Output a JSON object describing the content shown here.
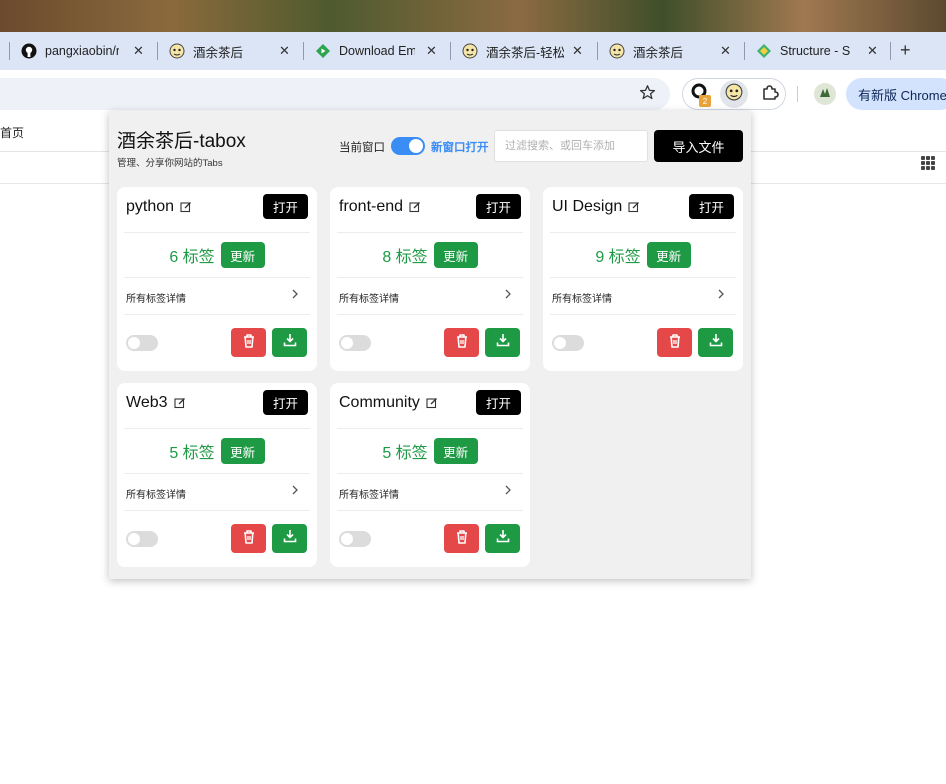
{
  "browser": {
    "tabs": [
      {
        "title": "pangxiaobin/r",
        "icon": "github-icon"
      },
      {
        "title": "酒余茶后",
        "icon": "tabox-icon"
      },
      {
        "title": "Download Em",
        "icon": "play-icon"
      },
      {
        "title": "酒余茶后-轻松",
        "icon": "tabox-icon"
      },
      {
        "title": "酒余茶后",
        "icon": "tabox-icon"
      },
      {
        "title": "Structure - S",
        "icon": "structure-icon"
      }
    ],
    "close_glyph": "✕",
    "new_tab_glyph": "+",
    "extension_badge": "2",
    "update_label": "有新版 Chrome",
    "bookmark_home": "首页",
    "accent": "#dbe5f6"
  },
  "popup": {
    "title": "酒余茶后-tabox",
    "subtitle": "管理、分享你网站的Tabs",
    "current_window_label": "当前窗口",
    "new_window_label": "新窗口打开",
    "search_placeholder": "过滤搜索、或回车添加",
    "import_label": "导入文件",
    "colors": {
      "open": "#000000",
      "count": "#1e9a45",
      "delete": "#e54848",
      "toggle_on": "#3a8df5"
    },
    "cards": [
      {
        "name": "python",
        "open_label": "打开",
        "count_text": "6 标签",
        "update_label": "更新",
        "details_label": "所有标签详情",
        "enabled": false
      },
      {
        "name": "front-end",
        "open_label": "打开",
        "count_text": "8 标签",
        "update_label": "更新",
        "details_label": "所有标签详情",
        "enabled": false
      },
      {
        "name": "UI Design",
        "open_label": "打开",
        "count_text": "9 标签",
        "update_label": "更新",
        "details_label": "所有标签详情",
        "enabled": false
      },
      {
        "name": "Web3",
        "open_label": "打开",
        "count_text": "5 标签",
        "update_label": "更新",
        "details_label": "所有标签详情",
        "enabled": false
      },
      {
        "name": "Community",
        "open_label": "打开",
        "count_text": "5 标签",
        "update_label": "更新",
        "details_label": "所有标签详情",
        "enabled": false
      }
    ]
  }
}
